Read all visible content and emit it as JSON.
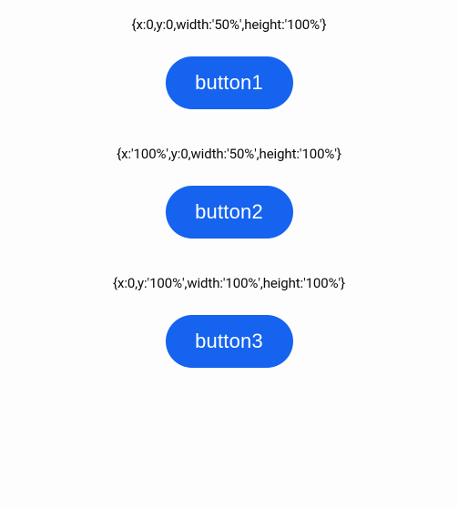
{
  "items": [
    {
      "config_text": "{x:0,y:0,width:'50%',height:'100%'}",
      "button_label": "button1"
    },
    {
      "config_text": "{x:'100%',y:0,width:'50%',height:'100%'}",
      "button_label": "button2"
    },
    {
      "config_text": "{x:0,y:'100%',width:'100%',height:'100%'}",
      "button_label": "button3"
    }
  ]
}
